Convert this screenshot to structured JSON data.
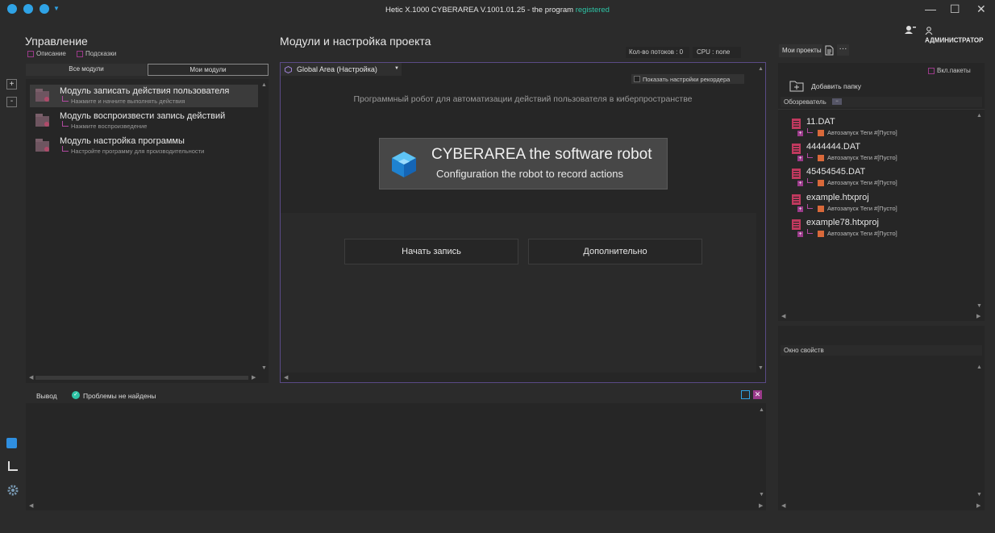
{
  "window": {
    "title_main": "Hetic X.1000 CYBERAREA V.1001.01.25 - the program",
    "title_status": "registered",
    "minimize": "—",
    "maximize": "☐",
    "close": "✕"
  },
  "user": {
    "name": "АДМИНИСТРАТОР"
  },
  "left": {
    "title": "Управление",
    "opt_description": "Описание",
    "opt_hints": "Подсказки",
    "tab_all": "Все модули",
    "tab_mine": "Мои модули",
    "zoom_in": "+",
    "zoom_out": "-",
    "modules": [
      {
        "title": "Модуль записать действия пользователя",
        "hint": "Нажмите и начните выполнять действия"
      },
      {
        "title": "Модуль воспроизвести запись действий",
        "hint": "Нажмите воспроизведение"
      },
      {
        "title": "Модуль настройка программы",
        "hint": "Настройте программу для производительности"
      }
    ]
  },
  "center": {
    "title": "Модули и настройка проекта",
    "threads": "Кол-во потоков : 0",
    "cpu": "CPU : none",
    "area_select": "Global Area (Настройка)",
    "show_recorder": "Показать настройки рекордера",
    "description": "Программный робот для автоматизации действий пользователя в киберпространстве",
    "banner_title": "CYBERAREA the software robot",
    "banner_subtitle": "Configuration the robot to record actions",
    "btn_record": "Начать запись",
    "btn_more": "Дополнительно"
  },
  "right": {
    "tab_projects": "Мои проекты",
    "more": "···",
    "packages": "Вкл.пакеты",
    "add_folder": "Добавить папку",
    "explorer": "Обозреватель",
    "properties": "Окно свойств",
    "projects": [
      {
        "name": "11.DAT",
        "tags": "Автозапуск Теги #[Пусто]"
      },
      {
        "name": "4444444.DAT",
        "tags": "Автозапуск Теги #[Пусто]"
      },
      {
        "name": "45454545.DAT",
        "tags": "Автозапуск Теги #[Пусто]"
      },
      {
        "name": "example.htxproj",
        "tags": "Автозапуск Теги #[Пусто]"
      },
      {
        "name": "example78.htxproj",
        "tags": "Автозапуск Теги #[Пусто]"
      }
    ]
  },
  "output": {
    "tab": "Вывод",
    "status": "Проблемы не найдены"
  },
  "colors": {
    "accent": "#2fa3e6",
    "registered": "#2ec4a6",
    "magenta": "#9b3a8a",
    "file": "#c0395e",
    "tag": "#d9693a"
  }
}
